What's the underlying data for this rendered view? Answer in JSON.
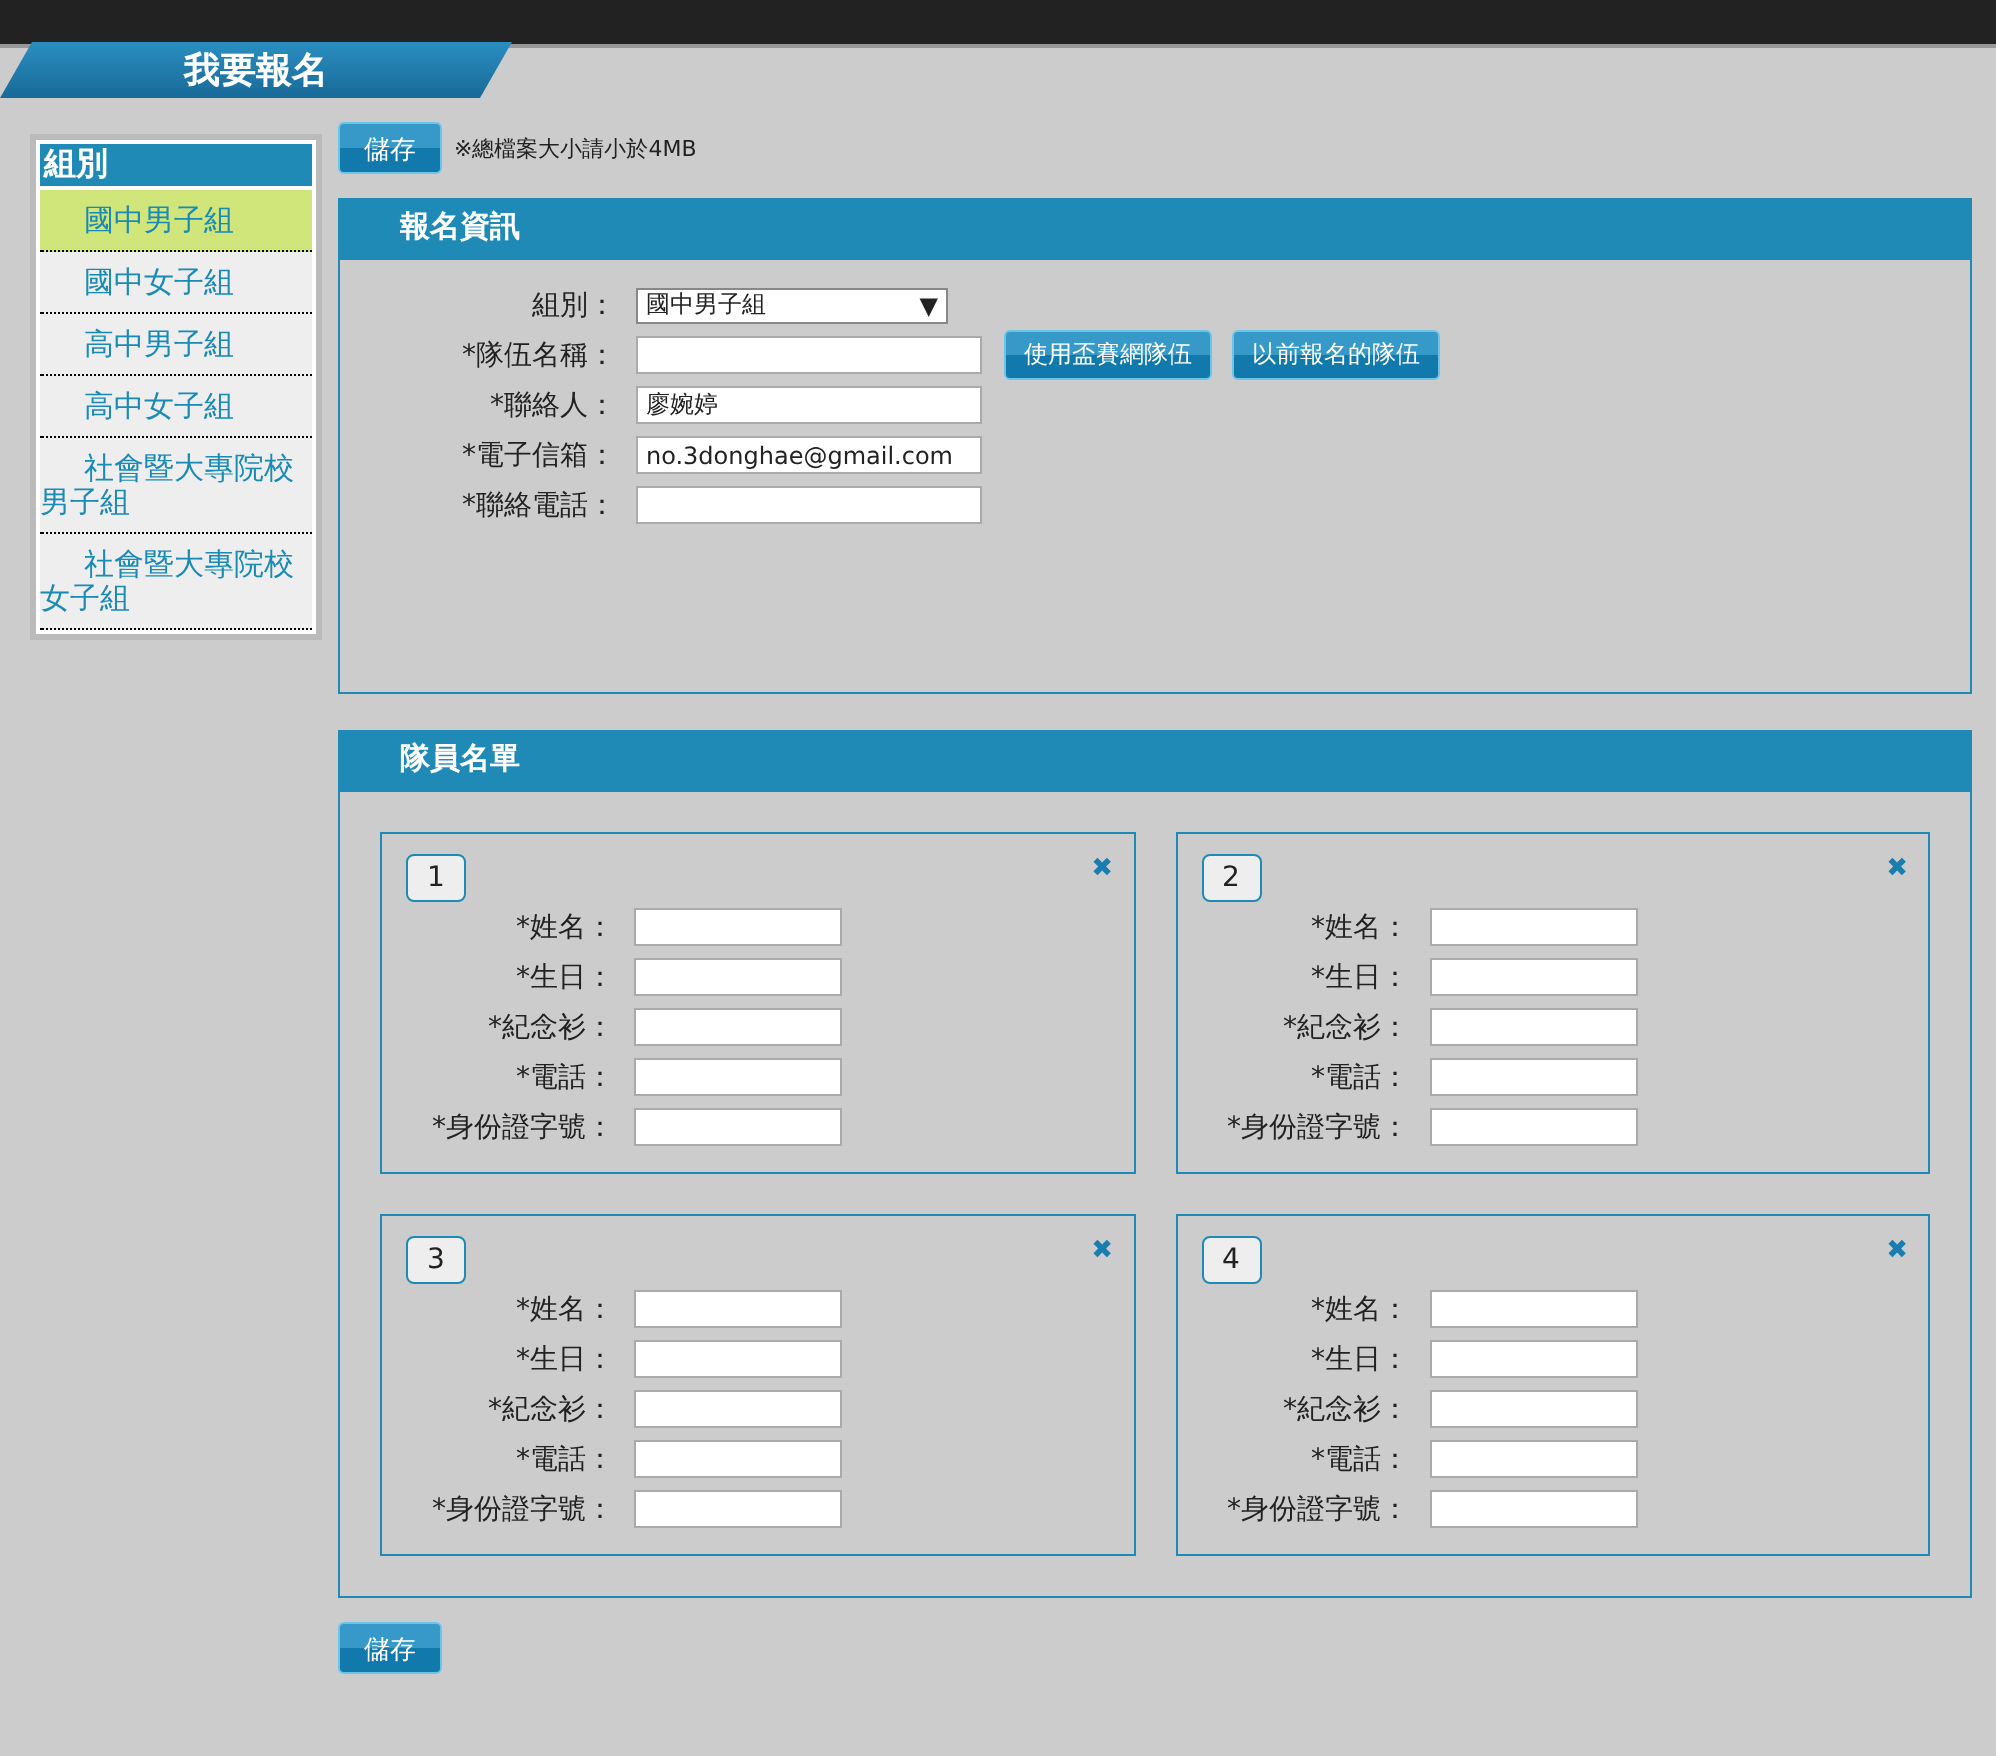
{
  "page_title": "我要報名",
  "sidebar": {
    "heading": "組別",
    "items": [
      {
        "label": "國中男子組",
        "selected": true
      },
      {
        "label": "國中女子組",
        "selected": false
      },
      {
        "label": "高中男子組",
        "selected": false
      },
      {
        "label": "高中女子組",
        "selected": false
      },
      {
        "label": "社會暨大專院校男子組",
        "selected": false
      },
      {
        "label": "社會暨大專院校女子組",
        "selected": false
      }
    ]
  },
  "top_save": "儲存",
  "size_note": "※總檔案大小請小於4MB",
  "registration": {
    "heading": "報名資訊",
    "fields": [
      {
        "kind": "select",
        "label": "組別：",
        "value": "國中男子組",
        "arrow": "▼"
      },
      {
        "kind": "text",
        "label": "*隊伍名稱：",
        "buttons": [
          "使用盃賽網隊伍",
          "以前報名的隊伍"
        ]
      },
      {
        "kind": "text",
        "label": "*聯絡人：",
        "value": "廖婉婷"
      },
      {
        "kind": "text",
        "label": "*電子信箱：",
        "value": "no.3donghae@gmail.com"
      },
      {
        "kind": "text",
        "label": "*聯絡電話："
      }
    ]
  },
  "members": {
    "heading": "隊員名單",
    "cards": [
      {
        "number": "1",
        "close": "✖",
        "fields": [
          "*姓名：",
          "*生日：",
          "*紀念衫：",
          "*電話：",
          "*身份證字號："
        ]
      },
      {
        "number": "2",
        "close": "✖",
        "fields": [
          "*姓名：",
          "*生日：",
          "*紀念衫：",
          "*電話：",
          "*身份證字號："
        ]
      },
      {
        "number": "3",
        "close": "✖",
        "fields": [
          "*姓名：",
          "*生日：",
          "*紀念衫：",
          "*電話：",
          "*身份證字號："
        ]
      },
      {
        "number": "4",
        "close": "✖",
        "fields": [
          "*姓名：",
          "*生日：",
          "*紀念衫：",
          "*電話：",
          "*身份證字號："
        ]
      }
    ]
  },
  "bottom_save": "儲存"
}
